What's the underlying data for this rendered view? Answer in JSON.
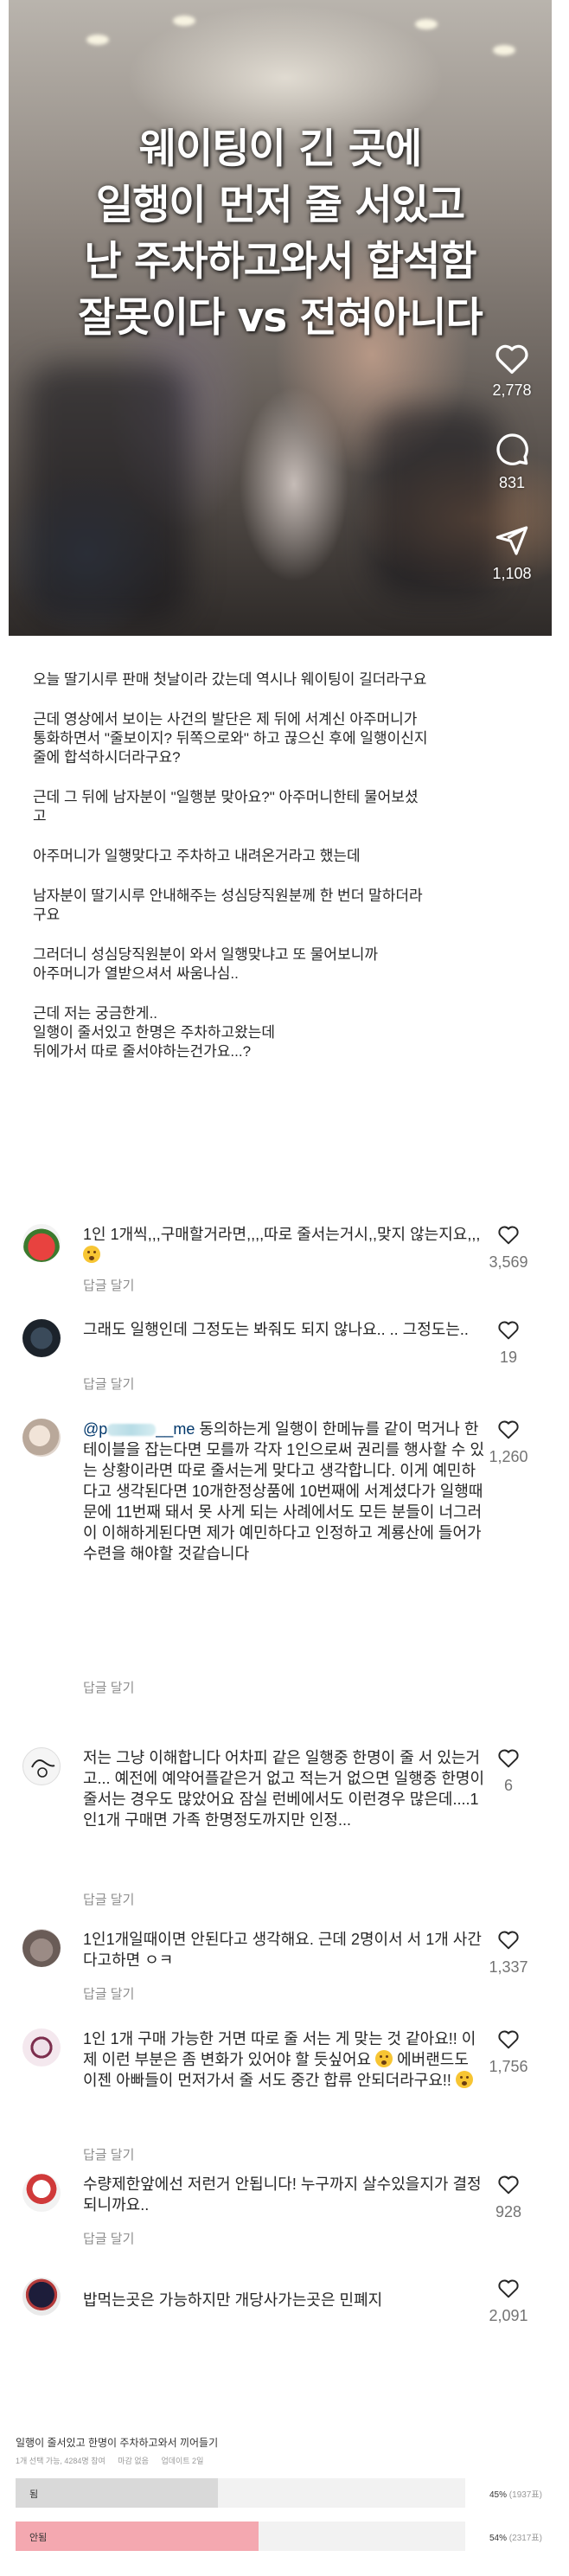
{
  "video": {
    "title_lines": [
      "웨이팅이 긴 곳에",
      "일행이 먼저 줄 서있고",
      "난 주차하고와서 합석함",
      "잘못이다 vs 전혀아니다"
    ],
    "likes": "2,778",
    "comments": "831",
    "shares": "1,108",
    "icons": [
      "heart-icon",
      "comment-bubble-icon",
      "share-plane-icon"
    ]
  },
  "post": {
    "paragraphs": [
      "오늘 딸기시루 판매 첫날이라 갔는데 역시나 웨이팅이 길더라구요",
      "근데 영상에서 보이는 사건의 발단은 제 뒤에 서계신 아주머니가\n통화하면서 \"줄보이지? 뒤쪽으로와\" 하고 끊으신 후에 일행이신지\n줄에 합석하시더라구요?",
      "근데 그 뒤에 남자분이 \"일행분 맞아요?\" 아주머니한테 물어보셨\n고",
      "아주머니가 일행맞다고 주차하고 내려온거라고 했는데",
      "남자분이 딸기시루 안내해주는 성심당직원분께 한 번더 말하더라\n구요",
      "그러더니 성심당직원분이 와서 일행맞냐고 또 물어보니까\n아주머니가 열받으셔서 싸움나심..",
      "근데 저는 궁금한게..\n일행이 줄서있고 한명은 주차하고왔는데\n뒤에가서 따로 줄서야하는건가요...?"
    ]
  },
  "comments": [
    {
      "text": "1인 1개씩,,,구매할거라면,,,,따로 줄서는거시,,맞지 않는지요,,,",
      "emoji": true,
      "reply": "답글 달기",
      "likes": "3,569"
    },
    {
      "text": "그래도 일행인데 그정도는 봐줘도 되지 않나요.. .. 그정도는..",
      "emoji": false,
      "reply": "답글 달기",
      "likes": "19"
    },
    {
      "mention_prefix": "@p",
      "mention_suffix": "__me",
      "text": " 동의하는게 일행이 한메뉴를 같이 먹거나 한 테이블을 잡는다면 모를까 각자 1인으로써 권리를 행사할 수 있는 상황이라면 따로 줄서는게 맞다고 생각합니다. 이게 예민하다고 생각된다면 10개한정상품에 10번째에 서계셨다가 일행때문에 11번째 돼서 못 사게 되는 사례에서도 모든 분들이 너그러이 이해하게된다면 제가 예민하다고 인정하고 계룡산에 들어가 수련을 해야할 것같습니다",
      "emoji": false,
      "reply": "답글 달기",
      "likes": "1,260"
    },
    {
      "text": "저는 그냥 이해합니다 어차피 같은 일행중 한명이 줄 서 있는거고... 예전에 예약어플같은거 없고 적는거 없으면 일행중 한명이 줄서는 경우도 많았어요 잠실 런베에서도 이런경우 많은데....1인1개 구매면 가족 한명정도까지만 인정...",
      "emoji": false,
      "reply": "답글 달기",
      "likes": "6"
    },
    {
      "text": "1인1개일때이면 안된다고 생각해요. 근데 2명이서 서 1개 사간다고하면 ㅇㅋ",
      "emoji": false,
      "reply": "답글 달기",
      "likes": "1,337"
    },
    {
      "text": "1인 1개 구매 가능한 거면 따로 줄 서는 게 맞는 것 같아요!! 이제 이런 부분은 좀 변화가 있어야 할 듯싶어요",
      "text2": " 에버랜드도 이젠 아빠들이 먼저가서 줄 서도 중간 합류 안되더라구요!! ",
      "emoji": true,
      "reply": "답글 달기",
      "likes": "1,756"
    },
    {
      "text": "수량제한앞에선 저런거 안됩니다! 누구까지 살수있을지가 결정되니까요..",
      "emoji": false,
      "reply": "답글 달기",
      "likes": "928"
    },
    {
      "text": "밥먹는곳은 가능하지만 개당사가는곳은 민폐지",
      "emoji": false,
      "reply": "",
      "likes": "2,091"
    }
  ],
  "poll": {
    "title": "일행이 줄서있고 한명이 주차하고와서 끼어들기",
    "meta": [
      "1개 선택 가능, 4284명 참여",
      "마감 없음",
      "업데이트 2일"
    ],
    "options": [
      {
        "label": "됨",
        "percent": 45,
        "pct_text": "45%",
        "count_text": "(1937표)",
        "color": "#d9d9d9"
      },
      {
        "label": "안됨",
        "percent": 54,
        "pct_text": "54%",
        "count_text": "(2317표)",
        "color": "#f4a8b0"
      }
    ]
  }
}
